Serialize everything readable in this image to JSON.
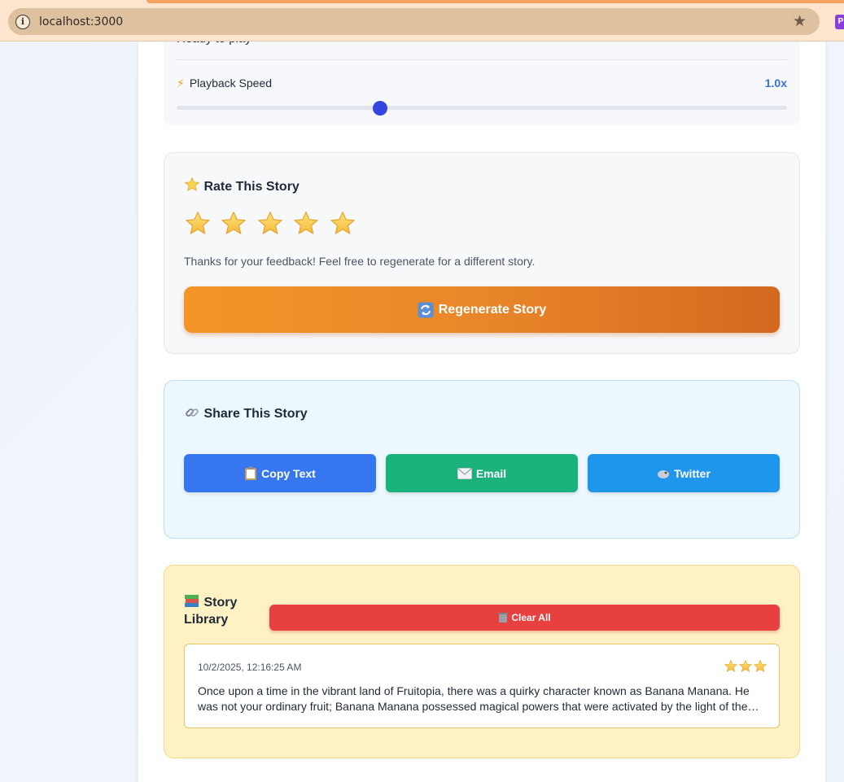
{
  "browser": {
    "url": "localhost:3000"
  },
  "audio": {
    "status": "Ready to play",
    "speed_label": "Playback Speed",
    "speed_value": "1.0x",
    "speed_fraction": 0.333
  },
  "rate": {
    "title": "Rate This Story",
    "star_count": 5,
    "feedback": "Thanks for your feedback! Feel free to regenerate for a different story.",
    "regenerate_label": "Regenerate Story"
  },
  "share": {
    "title": "Share This Story",
    "copy_label": "Copy Text",
    "email_label": "Email",
    "twitter_label": "Twitter"
  },
  "library": {
    "title": "Story Library",
    "clear_label": "Clear All",
    "items": [
      {
        "date": "10/2/2025, 12:16:25 AM",
        "rating": 3,
        "text": "Once upon a time in the vibrant land of Fruitopia, there was a quirky character known as Banana Manana. He was not your ordinary fruit; Banana Manana possessed magical powers that were activated by the light of the moon and the laughter of children."
      }
    ]
  },
  "colors": {
    "accent_blue": "#3b6fd8",
    "regen_orange": "#f39527",
    "copy_blue": "#3677ef",
    "email_green": "#1ab27a",
    "twitter_blue": "#1e96eb",
    "clear_red": "#e8403f"
  },
  "icons": {
    "speed": "lightning-icon",
    "rate": "star-icon",
    "regenerate": "refresh-icon",
    "share": "link-icon",
    "copy": "clipboard-icon",
    "email": "envelope-icon",
    "twitter": "bird-icon",
    "library": "books-icon",
    "clear": "trash-icon"
  }
}
